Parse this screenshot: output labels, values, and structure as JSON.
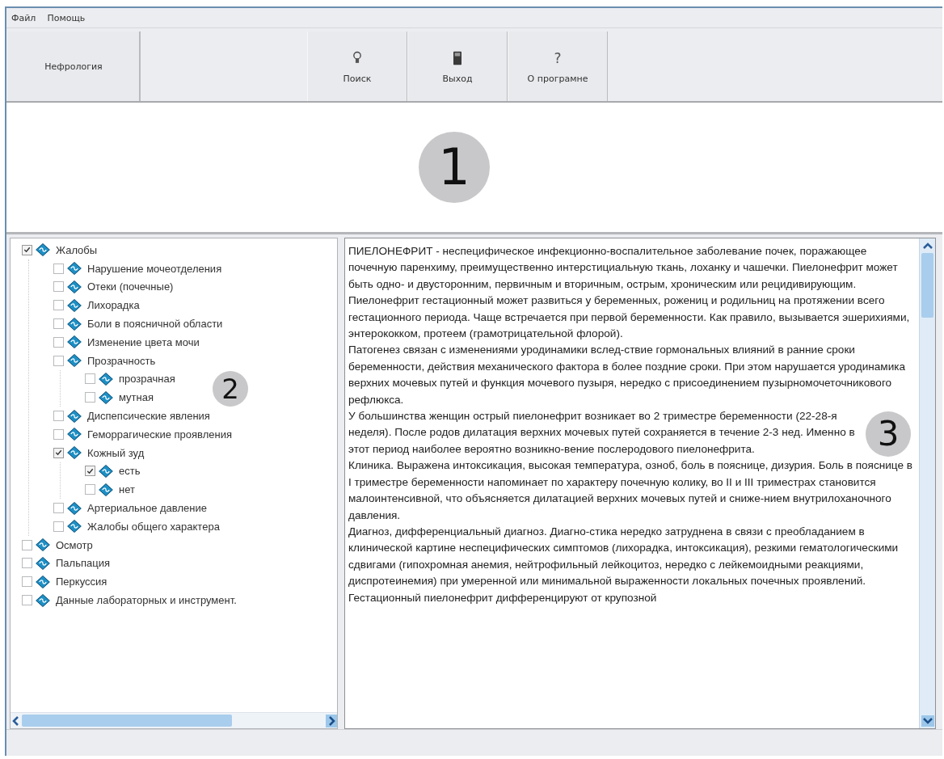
{
  "menu": [
    "Файл",
    "Помощь"
  ],
  "toolbar": {
    "section_button": "Нефрология",
    "buttons": [
      {
        "kind": "bulb",
        "label": "Поиск"
      },
      {
        "kind": "device",
        "label": "Выход"
      },
      {
        "kind": "glyph",
        "glyph": "?",
        "label": "О програмне"
      }
    ]
  },
  "top_area": {
    "callout": "1"
  },
  "tree": {
    "callout": "2",
    "items": [
      {
        "label": "Жалобы",
        "checked": true,
        "children": [
          {
            "label": "Нарушение мочеотделения",
            "checked": false
          },
          {
            "label": "Отеки (почечные)",
            "checked": false
          },
          {
            "label": "Лихорадка",
            "checked": false
          },
          {
            "label": "Боли в поясничной области",
            "checked": false
          },
          {
            "label": "Изменение цвета мочи",
            "checked": false
          },
          {
            "label": "Прозрачность",
            "checked": false,
            "children": [
              {
                "label": "прозрачная",
                "checked": false
              },
              {
                "label": "мутная",
                "checked": false
              }
            ]
          },
          {
            "label": "Диспепсические явления",
            "checked": false
          },
          {
            "label": "Геморрагические проявления",
            "checked": false
          },
          {
            "label": "Кожный зуд",
            "checked": true,
            "children": [
              {
                "label": "есть",
                "checked": true
              },
              {
                "label": "нет",
                "checked": false
              }
            ]
          },
          {
            "label": "Артериальное давление",
            "checked": false
          },
          {
            "label": "Жалобы общего характера",
            "checked": false
          }
        ]
      },
      {
        "label": "Осмотр",
        "checked": false
      },
      {
        "label": "Пальпация",
        "checked": false
      },
      {
        "label": "Перкуссия",
        "checked": false
      },
      {
        "label": "Данные лабораторных и инструмент.",
        "checked": false
      }
    ]
  },
  "text_panel": {
    "callout": "3",
    "paragraphs": [
      "ПИЕЛОНЕФРИТ - неспецифическое инфекционно-воспалительное заболевание почек, поражающее почечную паренхиму, преимущественно интерстициальную ткань, лоханку и чашечки. Пиелонефрит может быть одно- и двусторонним, первичным и вторичным, острым, хроническим или рецидивирующим.",
      "Пиелонефрит гестационный может развиться у беременных, рожениц и родильниц на протяжении всего гестационного периода. Чаще встречается при первой беременности. Как правило, вызывается эшерихиями, энтерококком, протеем (грамотрицательной флорой).",
      "Патогенез связан с изменениями уродинамики вслед-ствие гормональных влияний в ранние сроки беременности, действия механического фактора в более поздние сроки. При этом нарушается уродинамика верхних мочевых путей и функция мочевого пузыря, нередко с присоединением пузырномочеточникового рефлюкса.",
      "У большинства женщин острый пиелонефрит возникает во 2 триместре беременности (22-28-я неделя). После родов дилатация верхних мочевых путей сохраняется в течение 2-3 нед. Именно в этот период наиболее вероятно возникно-вение послеродового пиелонефрита.",
      "Клиника. Выражена интоксикация, высокая температура, озноб, боль в пояснице, дизурия. Боль в пояснице в I триместре беременности напоминает по характеру почечную колику, во II и III триместрах становится малоинтенсивной, что объясняется дилатацией верхних мочевых путей и сниже-нием внутрилоханочного давления.",
      "Диагноз, дифференциальный диагноз. Диагно-стика нередко затруднена в связи с преобладанием в клинической картине неспецифических симптомов (лихорадка, интоксикация), резкими гематологическими сдвигами (гипохромная анемия, нейтрофильный лейкоцитоз, нередко с лейкемоидными реакциями, диспротеинемия) при умеренной или минимальной выраженности локальных почечных проявлений. Гестационный пиелонефрит дифференцируют от крупозной"
    ]
  }
}
